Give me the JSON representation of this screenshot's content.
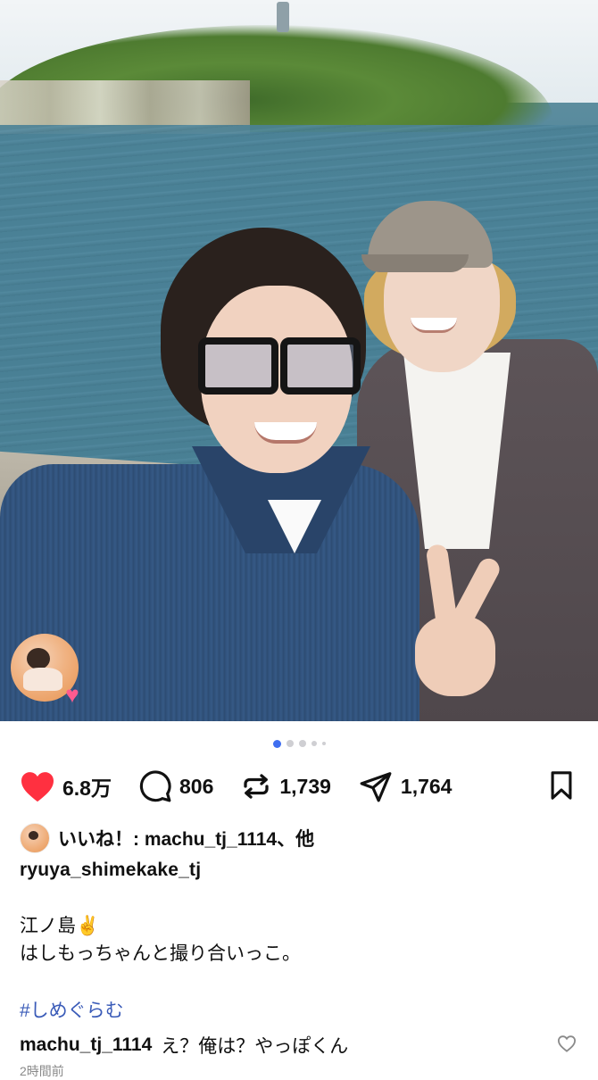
{
  "post": {
    "carousel": {
      "pages": 5,
      "active_index": 0
    },
    "actions": {
      "like_count": "6.8万",
      "comment_count": "806",
      "repost_count": "1,739",
      "share_count": "1,764"
    },
    "likes_text": "いいね！: machu_tj_1114、他",
    "username": "ryuya_shimekake_tj",
    "caption_lines": [
      "江ノ島✌️",
      "はしもっちゃんと撮り合いっこ。"
    ],
    "hashtag": "#しめぐらむ",
    "comment": {
      "user": "machu_tj_1114",
      "text": "え？俺は？やっぽくん"
    },
    "time": "2時間前"
  },
  "colors": {
    "like_red": "#ff3040",
    "link_blue": "#3a5bb8",
    "dot_active": "#3f6ef0"
  },
  "icons": [
    "heart-icon",
    "comment-icon",
    "repost-icon",
    "share-icon",
    "bookmark-icon",
    "comment-like-icon"
  ]
}
